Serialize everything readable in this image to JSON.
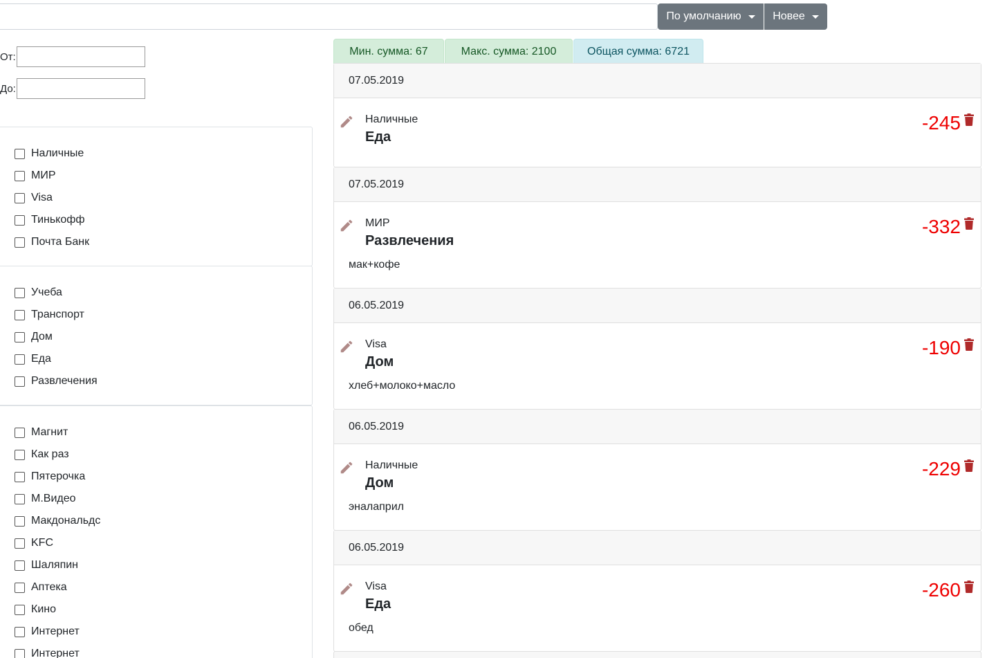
{
  "toolbar": {
    "search_value": "",
    "sort_label": "По умолчанию",
    "order_label": "Новее"
  },
  "filters": {
    "from_label": "От:",
    "to_label": "До:",
    "from_value": "",
    "to_value": ""
  },
  "accounts": [
    "Наличные",
    "МИР",
    "Visa",
    "Тинькофф",
    "Почта Банк"
  ],
  "categories": [
    "Учеба",
    "Транспорт",
    "Дом",
    "Еда",
    "Развлечения"
  ],
  "shops": [
    "Магнит",
    "Как раз",
    "Пятерочка",
    "М.Видео",
    "Макдональдс",
    "KFC",
    "Шаляпин",
    "Аптека",
    "Кино",
    "Интернет",
    "Интернет"
  ],
  "stats": {
    "min_label": "Мин. сумма: 67",
    "max_label": "Макс. сумма: 2100",
    "total_label": "Общая сумма: 6721"
  },
  "transactions": [
    {
      "date": "07.05.2019",
      "account": "Наличные",
      "category": "Еда",
      "note": "",
      "amount": "-245"
    },
    {
      "date": "07.05.2019",
      "account": "МИР",
      "category": "Развлечения",
      "note": "мак+кофе",
      "amount": "-332"
    },
    {
      "date": "06.05.2019",
      "account": "Visa",
      "category": "Дом",
      "note": "хлеб+молоко+масло",
      "amount": "-190"
    },
    {
      "date": "06.05.2019",
      "account": "Наличные",
      "category": "Дом",
      "note": "эналаприл",
      "amount": "-229"
    },
    {
      "date": "06.05.2019",
      "account": "Visa",
      "category": "Еда",
      "note": "обед",
      "amount": "-260"
    }
  ],
  "colors": {
    "amount": "#ee0000",
    "trash_icon": "#b02a2a",
    "pencil_icon": "#b08a88",
    "button_bg": "#6c757d"
  }
}
